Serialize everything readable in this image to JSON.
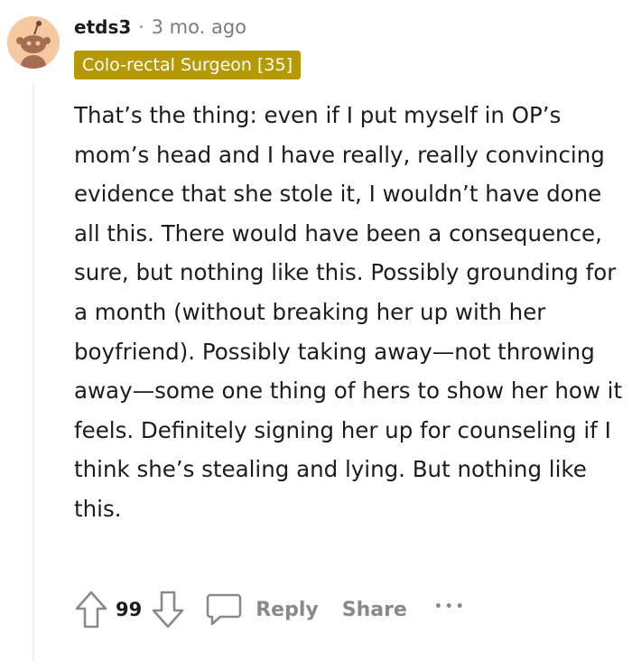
{
  "comment": {
    "username": "etds3",
    "separator": "·",
    "timestamp": "3 mo. ago",
    "flair": "Colo-rectal Surgeon [35]",
    "flair_color": "#b59a06",
    "avatar_color": "#f7c9a1",
    "body": "That’s the thing: even if I put myself in OP’s mom’s head and I have really, really convincing evidence that she stole it, I wouldn’t have done all this. There would have been a consequence, sure, but nothing like this. Possibly grounding for a month (without breaking her up with her boyfriend). Possibly taking away—not throwing away—some one thing of hers to show her how it feels. Definitely signing her up for counseling if I think she’s stealing and lying. But nothing like this."
  },
  "actions": {
    "upvote_icon": "arrow-up-icon",
    "vote_count": "99",
    "downvote_icon": "arrow-down-icon",
    "reply_icon": "comment-bubble-icon",
    "reply_label": "Reply",
    "share_label": "Share",
    "more_icon": "ellipsis-icon",
    "more_label": "•••"
  }
}
